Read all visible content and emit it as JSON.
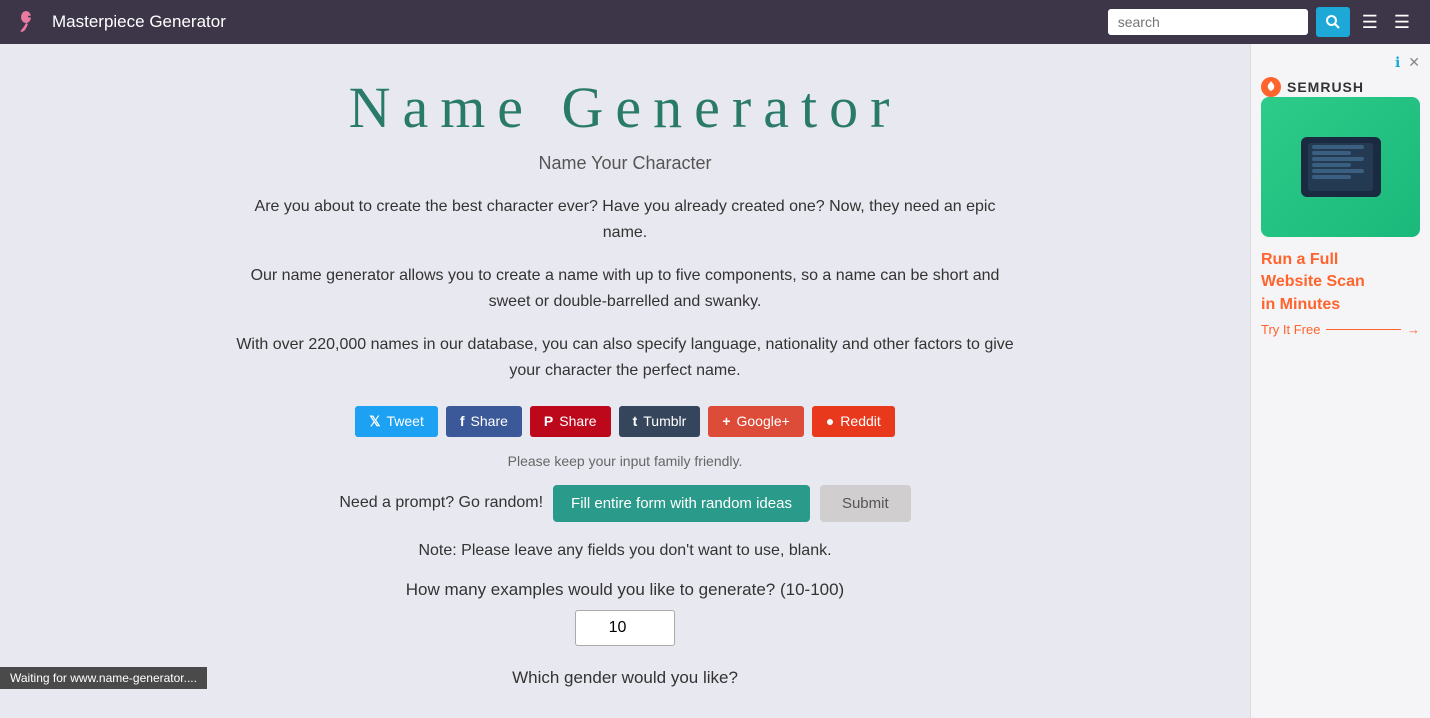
{
  "header": {
    "title": "Masterpiece Generator",
    "search_placeholder": "search",
    "logo_alt": "flamingo logo"
  },
  "page": {
    "title": "Name Generator",
    "subtitle": "Name Your Character",
    "description1": "Are you about to create the best character ever? Have you already created one? Now, they need an epic name.",
    "description2": "Our name generator allows you to create a name with up to five components, so a name can be short and sweet or double-barrelled and swanky.",
    "description3": "With over 220,000 names in our database, you can also specify language, nationality and other factors to give your character the perfect name.",
    "family_note": "Please keep your input family friendly.",
    "prompt_text": "Need a prompt? Go random!",
    "fill_random_label": "Fill entire form with random ideas",
    "submit_label": "Submit",
    "note_text": "Note: Please leave any fields you don't want to use, blank.",
    "count_label": "How many examples would you like to generate? (10-100)",
    "count_value": "10",
    "gender_label": "Which gender would you like?"
  },
  "social_buttons": [
    {
      "label": "Tweet",
      "icon": "t",
      "type": "twitter"
    },
    {
      "label": "Share",
      "icon": "f",
      "type": "facebook"
    },
    {
      "label": "Share",
      "icon": "p",
      "type": "pinterest"
    },
    {
      "label": "Tumblr",
      "icon": "t",
      "type": "tumblr"
    },
    {
      "label": "Google+",
      "icon": "+",
      "type": "google"
    },
    {
      "label": "Reddit",
      "icon": "r",
      "type": "reddit"
    }
  ],
  "ad": {
    "brand": "SEMRUSH",
    "headline_line1": "Run a Full",
    "headline_line2": "Website Scan",
    "headline_line3": "in Minutes",
    "cta": "Try It Free"
  },
  "status_bar": {
    "text": "Waiting for www.name-generator...."
  }
}
